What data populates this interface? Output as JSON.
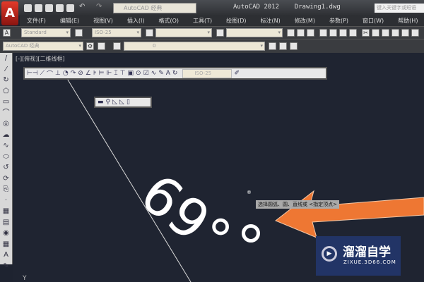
{
  "app": {
    "title": "AutoCAD 2012",
    "document": "Drawing1.dwg",
    "search_placeholder": "键入关键字或短语",
    "workspace": "AutoCAD 经典",
    "logo": "A"
  },
  "menu": [
    "文件(F)",
    "编辑(E)",
    "视图(V)",
    "插入(I)",
    "格式(O)",
    "工具(T)",
    "绘图(D)",
    "标注(N)",
    "修改(M)",
    "参数(P)",
    "窗口(W)",
    "帮助(H)"
  ],
  "styles": {
    "text_style": "Standard",
    "dim_style": "ISO-25",
    "layer": "0",
    "workspace2": "AutoCAD 经典"
  },
  "viewport": {
    "label": "[-][俯视][二维线框]"
  },
  "dim_toolbar": {
    "icons": [
      "linear",
      "aligned",
      "arc-length",
      "ordinate",
      "radius",
      "jogged",
      "diameter",
      "angular",
      "quick",
      "baseline",
      "continue",
      "space",
      "break",
      "tolerance",
      "center-mark",
      "inspect",
      "jogged-linear",
      "edit",
      "text-edit",
      "update"
    ],
    "style": "ISO-25"
  },
  "small_toolbar": {
    "icons": [
      "a",
      "b",
      "c",
      "d",
      "e"
    ]
  },
  "left_toolbar": [
    "/",
    "⁄",
    "↻",
    "⬠",
    "▭",
    "⌒",
    "◎",
    "☁",
    "∿",
    "⬭",
    "↺",
    "⟳",
    "⎘",
    "·",
    "▦",
    "▤",
    "◉",
    "▦",
    "A",
    "✎"
  ],
  "drawing": {
    "dimension_text": "69°"
  },
  "tooltip": "选择圆弧、圆、直线或 <指定顶点>",
  "watermark": {
    "name": "溜溜自学",
    "url": "ZIXUE.3D66.COM"
  },
  "colors": {
    "arrow": "#ee7733",
    "canvas": "#1f2431"
  }
}
